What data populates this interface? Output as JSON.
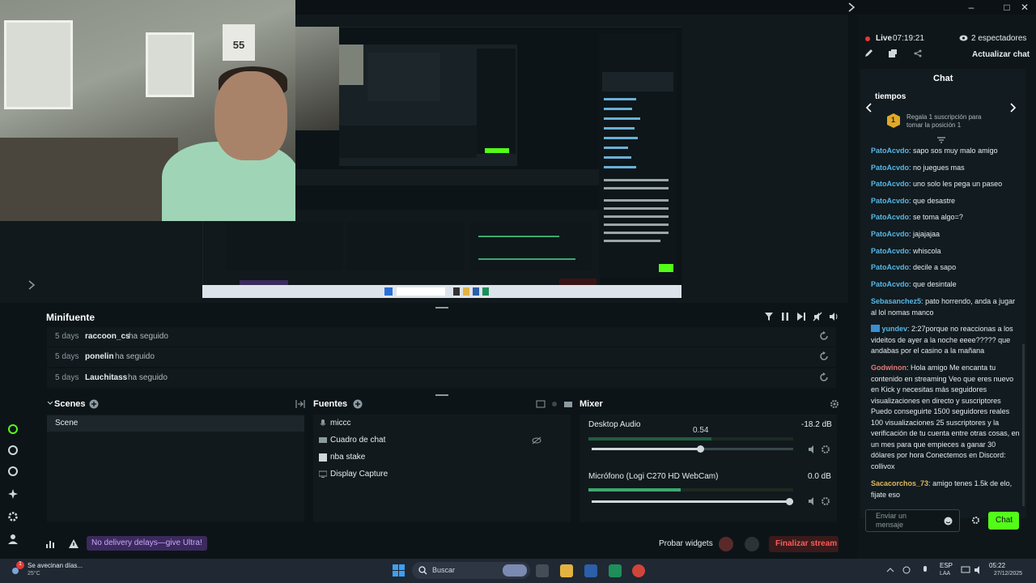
{
  "colors": {
    "bg": "#0c1418",
    "panel": "#11191d",
    "accent_green": "#53fc18",
    "live_red": "#e53935",
    "end_stream_red": "#e53935",
    "purple_badge": "#3b2a5c"
  },
  "window": {
    "controls": [
      "–",
      "□",
      "✕"
    ]
  },
  "camera": {
    "jersey_number": "55"
  },
  "minifeed": {
    "title": "Minifuente",
    "rows": [
      {
        "time": "5 days",
        "user": "raccoon_cs",
        "action": "ha seguido"
      },
      {
        "time": "5 days",
        "user": "ponelin",
        "action": "ha seguido"
      },
      {
        "time": "5 days",
        "user": "Lauchitass",
        "action": "ha seguido"
      }
    ]
  },
  "scenes": {
    "title": "Scenes",
    "items": [
      "Scene"
    ]
  },
  "sources": {
    "title": "Fuentes",
    "items": [
      {
        "label": "miccc",
        "icon": "mic-icon"
      },
      {
        "label": "Cuadro de chat",
        "icon": "chat-box-icon"
      },
      {
        "label": "nba stake",
        "icon": "globe-icon"
      },
      {
        "label": "Display Capture",
        "icon": "monitor-icon"
      }
    ]
  },
  "mixer": {
    "title": "Mixer",
    "channels": [
      {
        "name": "Desktop Audio",
        "db": "-18.2 dB",
        "value_label": "0.54",
        "level": 0.54
      },
      {
        "name": "Micrófono (Logi C270 HD WebCam)",
        "db": "0.0 dB",
        "level": 1.0
      }
    ]
  },
  "bottom": {
    "ultra_text": "No delivery delays—give Ultra!",
    "probar": "Probar widgets",
    "end_stream": "Finalizar stream"
  },
  "chat": {
    "live_label": "Live",
    "live_time": "07:19:21",
    "viewers": "2 espectadores",
    "refresh": "Actualizar chat",
    "title": "Chat",
    "carousel_title": "tiempos",
    "carousel_badge": "1",
    "carousel_text": "Regala 1 suscripción para tomar la posición 1",
    "messages": [
      {
        "user": "PatoAcvdo",
        "text": "sapo sos muy malo amigo",
        "color": "blue"
      },
      {
        "user": "PatoAcvdo",
        "text": "no juegues mas",
        "color": "blue"
      },
      {
        "user": "PatoAcvdo",
        "text": "uno solo les pega un paseo",
        "color": "blue"
      },
      {
        "user": "PatoAcvdo",
        "text": "que desastre",
        "color": "blue"
      },
      {
        "user": "PatoAcvdo",
        "text": "se toma algo=?",
        "color": "blue"
      },
      {
        "user": "PatoAcvdo",
        "text": "jajajajaa",
        "color": "blue"
      },
      {
        "user": "PatoAcvdo",
        "text": "whiscola",
        "color": "blue"
      },
      {
        "user": "PatoAcvdo",
        "text": "decile a sapo",
        "color": "blue"
      },
      {
        "user": "PatoAcvdo",
        "text": "que desintale",
        "color": "blue"
      },
      {
        "user": "Sebasanchez5",
        "text": "pato horrendo, anda a jugar al lol nomas manco",
        "color": "blue"
      },
      {
        "user": "yundev",
        "text": "2:27porque no reaccionas a los videitos de ayer a la noche eeee????? que andabas por el casino a la mañana",
        "color": "blue"
      },
      {
        "user": "Godwinon",
        "text": "Hola amigo Me encanta tu contenido en streaming Veo que eres nuevo en Kick y necesitas más seguidores visualizaciones en directo y suscriptores Puedo conseguirte 1500 seguidores reales 100 visualizaciones 25 suscriptores y la verificación de tu cuenta entre otras cosas, en un mes para que empieces a ganar 30 dólares por hora Conectemos en Discord: collivox",
        "color": "red"
      },
      {
        "user": "Sacacorchos_73",
        "text": "amigo tenes 1.5k de elo, fijate eso",
        "color": "gold"
      }
    ],
    "input_placeholder": "Enviar un mensaje",
    "send_label": "Chat"
  },
  "taskbar": {
    "weather_title": "Se avecinan días...",
    "weather_temp": "25°C",
    "notif_count": "1",
    "search_placeholder": "Buscar",
    "lang": "ESP",
    "lang2": "LAA",
    "time": "05:22",
    "date": "27/12/2025"
  }
}
